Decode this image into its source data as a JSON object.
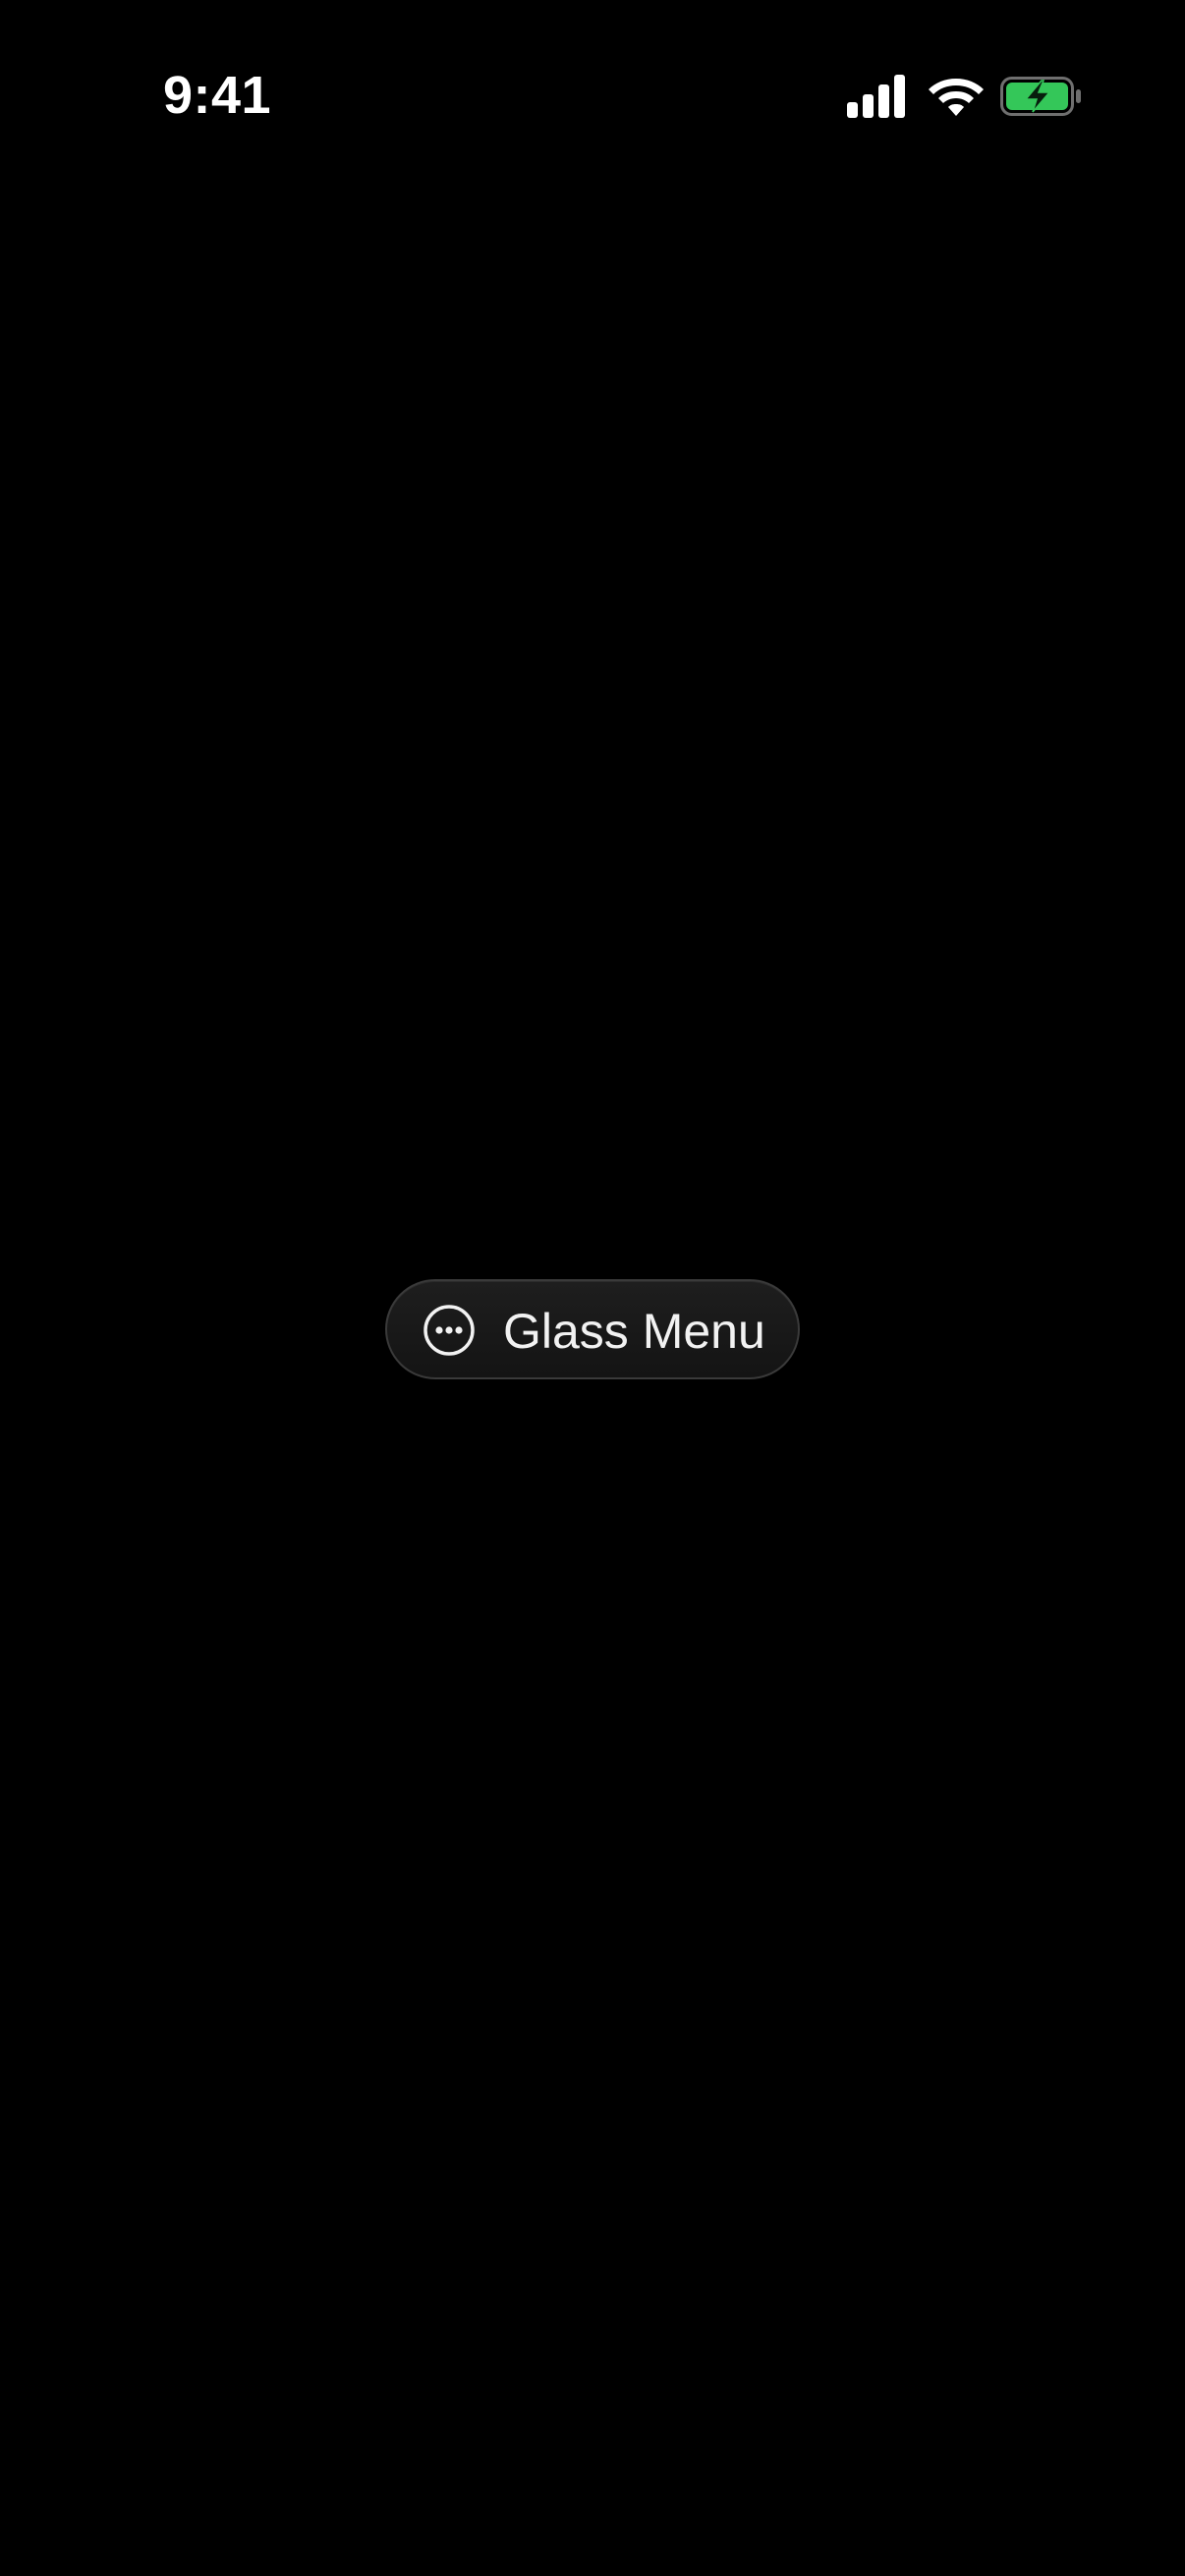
{
  "status_bar": {
    "time": "9:41",
    "icons": [
      "cellular-signal-icon",
      "wifi-icon",
      "battery-charging-icon"
    ],
    "battery_color": "#34C759"
  },
  "main": {
    "menu_button": {
      "label": "Glass Menu",
      "icon": "ellipsis-circle-icon"
    }
  },
  "colors": {
    "background": "#000000",
    "text": "#FFFFFF"
  }
}
